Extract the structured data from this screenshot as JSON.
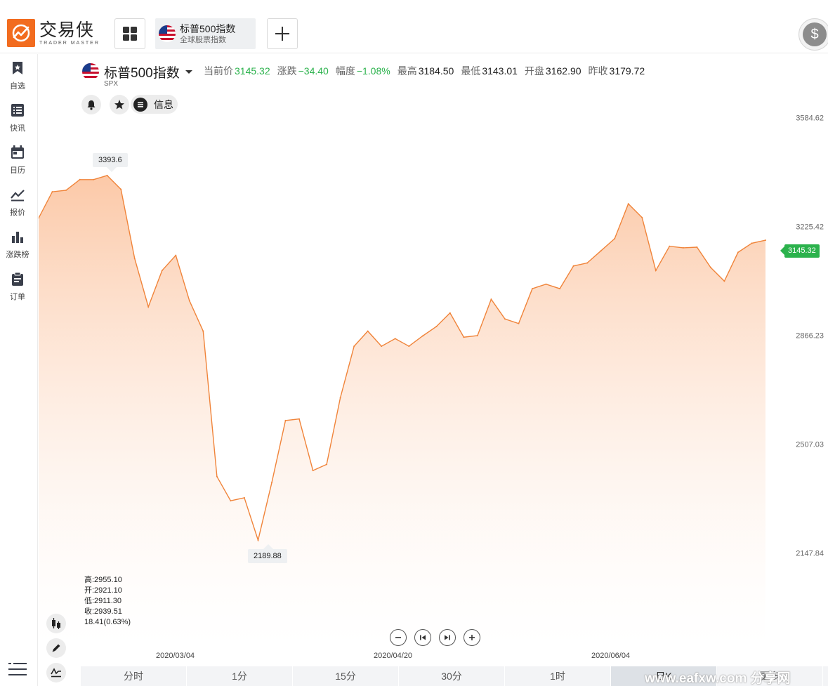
{
  "app": {
    "logo_cn": "交易侠",
    "logo_en": "TRADER MASTER"
  },
  "tabs": [
    {
      "title": "标普500指数",
      "subtitle": "全球股票指数"
    }
  ],
  "sidebar": {
    "items": [
      {
        "label": "自选",
        "icon": "bookmark-icon"
      },
      {
        "label": "快讯",
        "icon": "news-list-icon"
      },
      {
        "label": "日历",
        "icon": "calendar-icon"
      },
      {
        "label": "报价",
        "icon": "trend-line-icon"
      },
      {
        "label": "涨跌榜",
        "icon": "bar-chart-icon"
      },
      {
        "label": "订单",
        "icon": "clipboard-icon"
      }
    ]
  },
  "symbol": {
    "name": "标普500指数",
    "code": "SPX",
    "info_label": "信息"
  },
  "quotes": [
    {
      "label": "当前价",
      "value": "3145.32",
      "color": "green"
    },
    {
      "label": "涨跌",
      "value": "−34.40",
      "color": "green"
    },
    {
      "label": "幅度",
      "value": "−1.08%",
      "color": "green"
    },
    {
      "label": "最高",
      "value": "3184.50",
      "color": "dark"
    },
    {
      "label": "最低",
      "value": "3143.01",
      "color": "dark"
    },
    {
      "label": "开盘",
      "value": "3162.90",
      "color": "dark"
    },
    {
      "label": "昨收",
      "value": "3179.72",
      "color": "dark"
    }
  ],
  "ohlc": {
    "high": "高:2955.10",
    "open": "开:2921.10",
    "low": "低:2911.30",
    "close": "收:2939.51",
    "change": "18.41(0.63%)"
  },
  "tooltips": {
    "max": "3393.6",
    "min": "2189.88",
    "current": "3145.32"
  },
  "periods": [
    "分时",
    "1分",
    "15分",
    "30分",
    "1时",
    "日K",
    "更多"
  ],
  "active_period": "日K",
  "watermark": "www.eafxw.com 分享网",
  "colors": {
    "accent": "#f26c1f",
    "line": "#f0843a",
    "green": "#2bb24c"
  },
  "chart_data": {
    "type": "area",
    "title": "",
    "y_ticks": [
      3584.62,
      3225.42,
      2866.23,
      2507.03,
      2147.84
    ],
    "ylim": [
      2019,
      3700
    ],
    "x_tick_labels": [
      "2020/03/04",
      "2020/04/20",
      "2020/06/04"
    ],
    "series": [
      {
        "values": [
          3253,
          3340,
          3345,
          3380,
          3380,
          3393.6,
          3348,
          3120,
          2960,
          3080,
          3130,
          2980,
          2880,
          2400,
          2320,
          2330,
          2190,
          2380,
          2585,
          2590,
          2420,
          2440,
          2660,
          2830,
          2880,
          2830,
          2855,
          2830,
          2864,
          2895,
          2940,
          2860,
          2865,
          2985,
          2920,
          2905,
          3020,
          3035,
          3020,
          3095,
          3105,
          3145,
          3185,
          3300,
          3255,
          3080,
          3160,
          3155,
          3157,
          3090,
          3045,
          3140,
          3170,
          3180
        ]
      }
    ]
  }
}
